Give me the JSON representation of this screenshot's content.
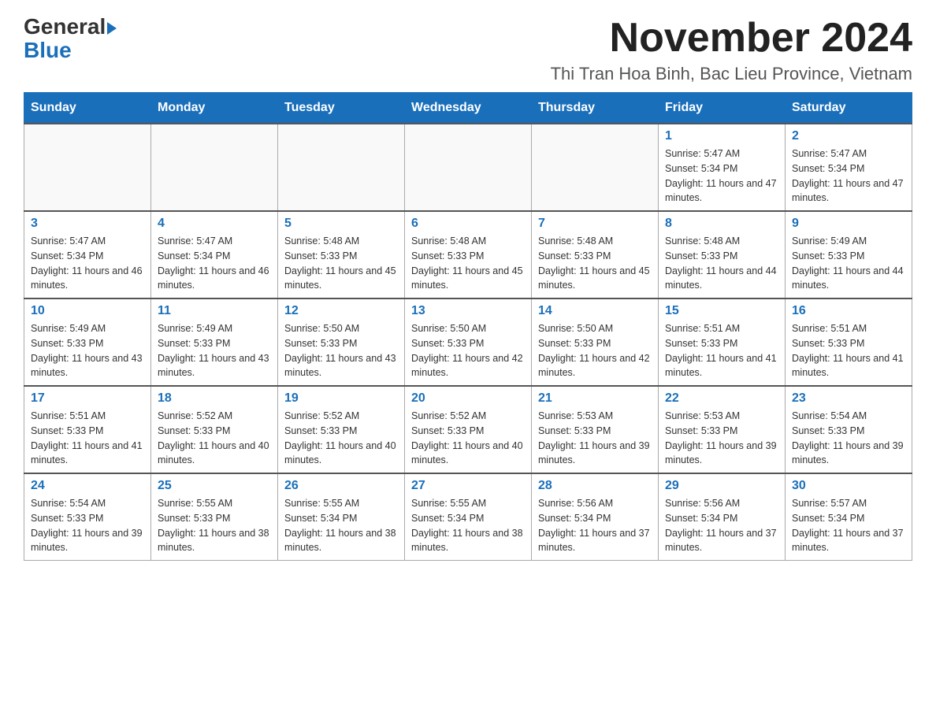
{
  "header": {
    "logo": {
      "general": "General",
      "blue": "Blue"
    },
    "title": "November 2024",
    "location": "Thi Tran Hoa Binh, Bac Lieu Province, Vietnam"
  },
  "weekdays": [
    "Sunday",
    "Monday",
    "Tuesday",
    "Wednesday",
    "Thursday",
    "Friday",
    "Saturday"
  ],
  "weeks": [
    [
      {
        "day": "",
        "sunrise": "",
        "sunset": "",
        "daylight": "",
        "empty": true
      },
      {
        "day": "",
        "sunrise": "",
        "sunset": "",
        "daylight": "",
        "empty": true
      },
      {
        "day": "",
        "sunrise": "",
        "sunset": "",
        "daylight": "",
        "empty": true
      },
      {
        "day": "",
        "sunrise": "",
        "sunset": "",
        "daylight": "",
        "empty": true
      },
      {
        "day": "",
        "sunrise": "",
        "sunset": "",
        "daylight": "",
        "empty": true
      },
      {
        "day": "1",
        "sunrise": "Sunrise: 5:47 AM",
        "sunset": "Sunset: 5:34 PM",
        "daylight": "Daylight: 11 hours and 47 minutes.",
        "empty": false
      },
      {
        "day": "2",
        "sunrise": "Sunrise: 5:47 AM",
        "sunset": "Sunset: 5:34 PM",
        "daylight": "Daylight: 11 hours and 47 minutes.",
        "empty": false
      }
    ],
    [
      {
        "day": "3",
        "sunrise": "Sunrise: 5:47 AM",
        "sunset": "Sunset: 5:34 PM",
        "daylight": "Daylight: 11 hours and 46 minutes.",
        "empty": false
      },
      {
        "day": "4",
        "sunrise": "Sunrise: 5:47 AM",
        "sunset": "Sunset: 5:34 PM",
        "daylight": "Daylight: 11 hours and 46 minutes.",
        "empty": false
      },
      {
        "day": "5",
        "sunrise": "Sunrise: 5:48 AM",
        "sunset": "Sunset: 5:33 PM",
        "daylight": "Daylight: 11 hours and 45 minutes.",
        "empty": false
      },
      {
        "day": "6",
        "sunrise": "Sunrise: 5:48 AM",
        "sunset": "Sunset: 5:33 PM",
        "daylight": "Daylight: 11 hours and 45 minutes.",
        "empty": false
      },
      {
        "day": "7",
        "sunrise": "Sunrise: 5:48 AM",
        "sunset": "Sunset: 5:33 PM",
        "daylight": "Daylight: 11 hours and 45 minutes.",
        "empty": false
      },
      {
        "day": "8",
        "sunrise": "Sunrise: 5:48 AM",
        "sunset": "Sunset: 5:33 PM",
        "daylight": "Daylight: 11 hours and 44 minutes.",
        "empty": false
      },
      {
        "day": "9",
        "sunrise": "Sunrise: 5:49 AM",
        "sunset": "Sunset: 5:33 PM",
        "daylight": "Daylight: 11 hours and 44 minutes.",
        "empty": false
      }
    ],
    [
      {
        "day": "10",
        "sunrise": "Sunrise: 5:49 AM",
        "sunset": "Sunset: 5:33 PM",
        "daylight": "Daylight: 11 hours and 43 minutes.",
        "empty": false
      },
      {
        "day": "11",
        "sunrise": "Sunrise: 5:49 AM",
        "sunset": "Sunset: 5:33 PM",
        "daylight": "Daylight: 11 hours and 43 minutes.",
        "empty": false
      },
      {
        "day": "12",
        "sunrise": "Sunrise: 5:50 AM",
        "sunset": "Sunset: 5:33 PM",
        "daylight": "Daylight: 11 hours and 43 minutes.",
        "empty": false
      },
      {
        "day": "13",
        "sunrise": "Sunrise: 5:50 AM",
        "sunset": "Sunset: 5:33 PM",
        "daylight": "Daylight: 11 hours and 42 minutes.",
        "empty": false
      },
      {
        "day": "14",
        "sunrise": "Sunrise: 5:50 AM",
        "sunset": "Sunset: 5:33 PM",
        "daylight": "Daylight: 11 hours and 42 minutes.",
        "empty": false
      },
      {
        "day": "15",
        "sunrise": "Sunrise: 5:51 AM",
        "sunset": "Sunset: 5:33 PM",
        "daylight": "Daylight: 11 hours and 41 minutes.",
        "empty": false
      },
      {
        "day": "16",
        "sunrise": "Sunrise: 5:51 AM",
        "sunset": "Sunset: 5:33 PM",
        "daylight": "Daylight: 11 hours and 41 minutes.",
        "empty": false
      }
    ],
    [
      {
        "day": "17",
        "sunrise": "Sunrise: 5:51 AM",
        "sunset": "Sunset: 5:33 PM",
        "daylight": "Daylight: 11 hours and 41 minutes.",
        "empty": false
      },
      {
        "day": "18",
        "sunrise": "Sunrise: 5:52 AM",
        "sunset": "Sunset: 5:33 PM",
        "daylight": "Daylight: 11 hours and 40 minutes.",
        "empty": false
      },
      {
        "day": "19",
        "sunrise": "Sunrise: 5:52 AM",
        "sunset": "Sunset: 5:33 PM",
        "daylight": "Daylight: 11 hours and 40 minutes.",
        "empty": false
      },
      {
        "day": "20",
        "sunrise": "Sunrise: 5:52 AM",
        "sunset": "Sunset: 5:33 PM",
        "daylight": "Daylight: 11 hours and 40 minutes.",
        "empty": false
      },
      {
        "day": "21",
        "sunrise": "Sunrise: 5:53 AM",
        "sunset": "Sunset: 5:33 PM",
        "daylight": "Daylight: 11 hours and 39 minutes.",
        "empty": false
      },
      {
        "day": "22",
        "sunrise": "Sunrise: 5:53 AM",
        "sunset": "Sunset: 5:33 PM",
        "daylight": "Daylight: 11 hours and 39 minutes.",
        "empty": false
      },
      {
        "day": "23",
        "sunrise": "Sunrise: 5:54 AM",
        "sunset": "Sunset: 5:33 PM",
        "daylight": "Daylight: 11 hours and 39 minutes.",
        "empty": false
      }
    ],
    [
      {
        "day": "24",
        "sunrise": "Sunrise: 5:54 AM",
        "sunset": "Sunset: 5:33 PM",
        "daylight": "Daylight: 11 hours and 39 minutes.",
        "empty": false
      },
      {
        "day": "25",
        "sunrise": "Sunrise: 5:55 AM",
        "sunset": "Sunset: 5:33 PM",
        "daylight": "Daylight: 11 hours and 38 minutes.",
        "empty": false
      },
      {
        "day": "26",
        "sunrise": "Sunrise: 5:55 AM",
        "sunset": "Sunset: 5:34 PM",
        "daylight": "Daylight: 11 hours and 38 minutes.",
        "empty": false
      },
      {
        "day": "27",
        "sunrise": "Sunrise: 5:55 AM",
        "sunset": "Sunset: 5:34 PM",
        "daylight": "Daylight: 11 hours and 38 minutes.",
        "empty": false
      },
      {
        "day": "28",
        "sunrise": "Sunrise: 5:56 AM",
        "sunset": "Sunset: 5:34 PM",
        "daylight": "Daylight: 11 hours and 37 minutes.",
        "empty": false
      },
      {
        "day": "29",
        "sunrise": "Sunrise: 5:56 AM",
        "sunset": "Sunset: 5:34 PM",
        "daylight": "Daylight: 11 hours and 37 minutes.",
        "empty": false
      },
      {
        "day": "30",
        "sunrise": "Sunrise: 5:57 AM",
        "sunset": "Sunset: 5:34 PM",
        "daylight": "Daylight: 11 hours and 37 minutes.",
        "empty": false
      }
    ]
  ]
}
